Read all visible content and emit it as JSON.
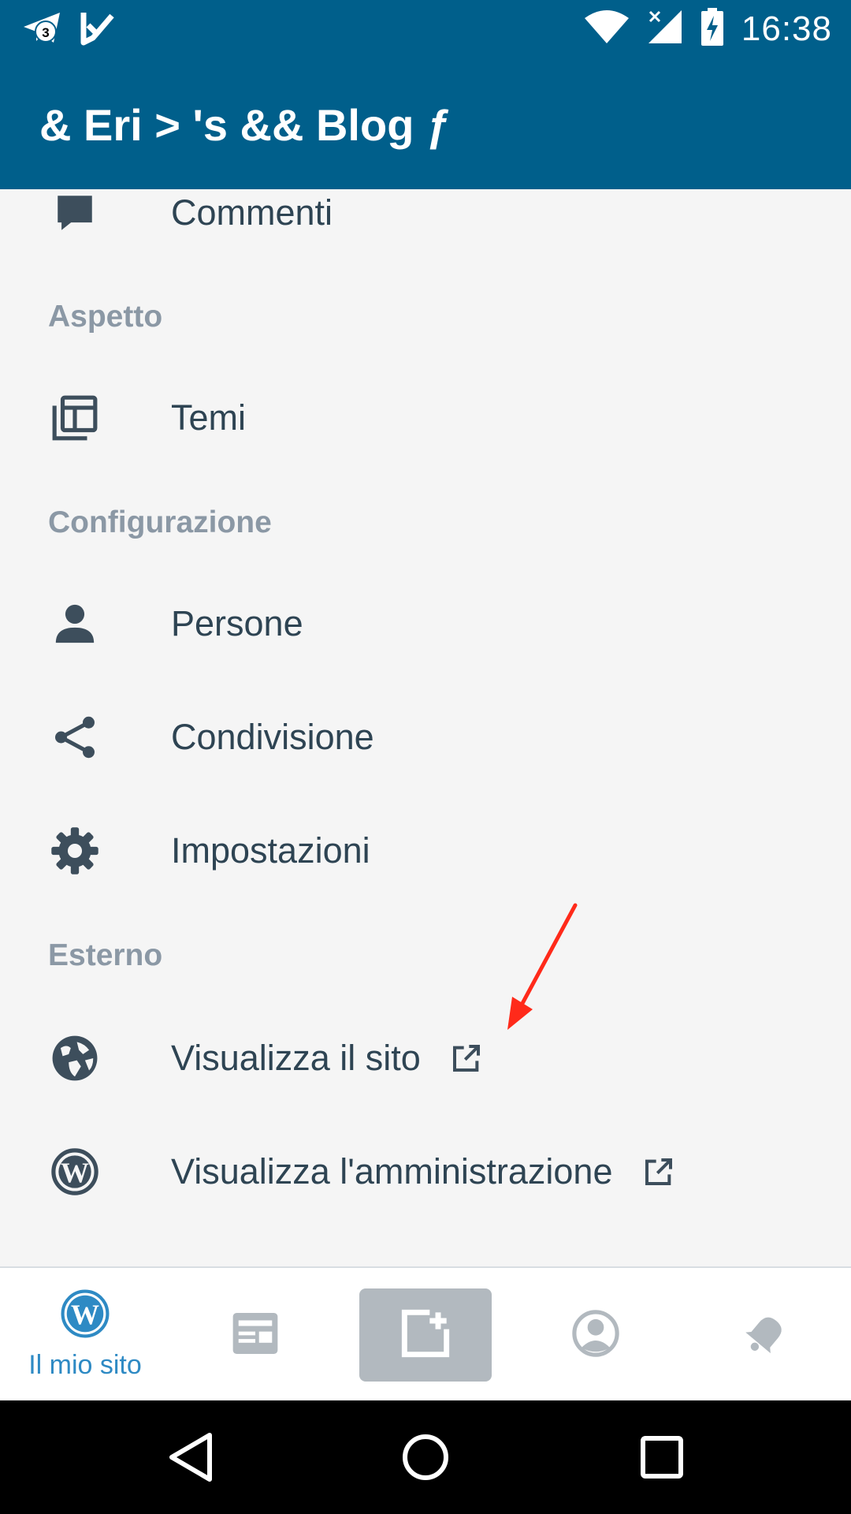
{
  "status_bar": {
    "time": "16:38",
    "notification_badge": "3",
    "icons": [
      "telegram-icon",
      "checkmark-icon",
      "wifi-icon",
      "signal-off-icon",
      "battery-charging-icon"
    ]
  },
  "app_bar": {
    "site_title": "& Eri > 's && Blog ƒ",
    "background_color": "#005f8b"
  },
  "menu": {
    "comments": {
      "label": "Commenti",
      "icon": "comment-icon"
    },
    "section_aspetto": "Aspetto",
    "themes": {
      "label": "Temi",
      "icon": "themes-icon"
    },
    "section_configurazione": "Configurazione",
    "people": {
      "label": "Persone",
      "icon": "person-icon"
    },
    "sharing": {
      "label": "Condivisione",
      "icon": "share-icon"
    },
    "settings": {
      "label": "Impostazioni",
      "icon": "gear-icon"
    },
    "section_esterno": "Esterno",
    "view_site": {
      "label": "Visualizza il sito",
      "icon": "globe-icon"
    },
    "view_admin": {
      "label": "Visualizza l'amministrazione",
      "icon": "wordpress-icon"
    }
  },
  "bottom_nav": {
    "my_site_label": "Il mio sito",
    "active_color": "#2e8ac4",
    "items": [
      "wordpress-icon",
      "reader-icon",
      "new-post-icon",
      "profile-icon",
      "notifications-icon"
    ]
  },
  "annotation": {
    "color": "#ff2a1a"
  }
}
